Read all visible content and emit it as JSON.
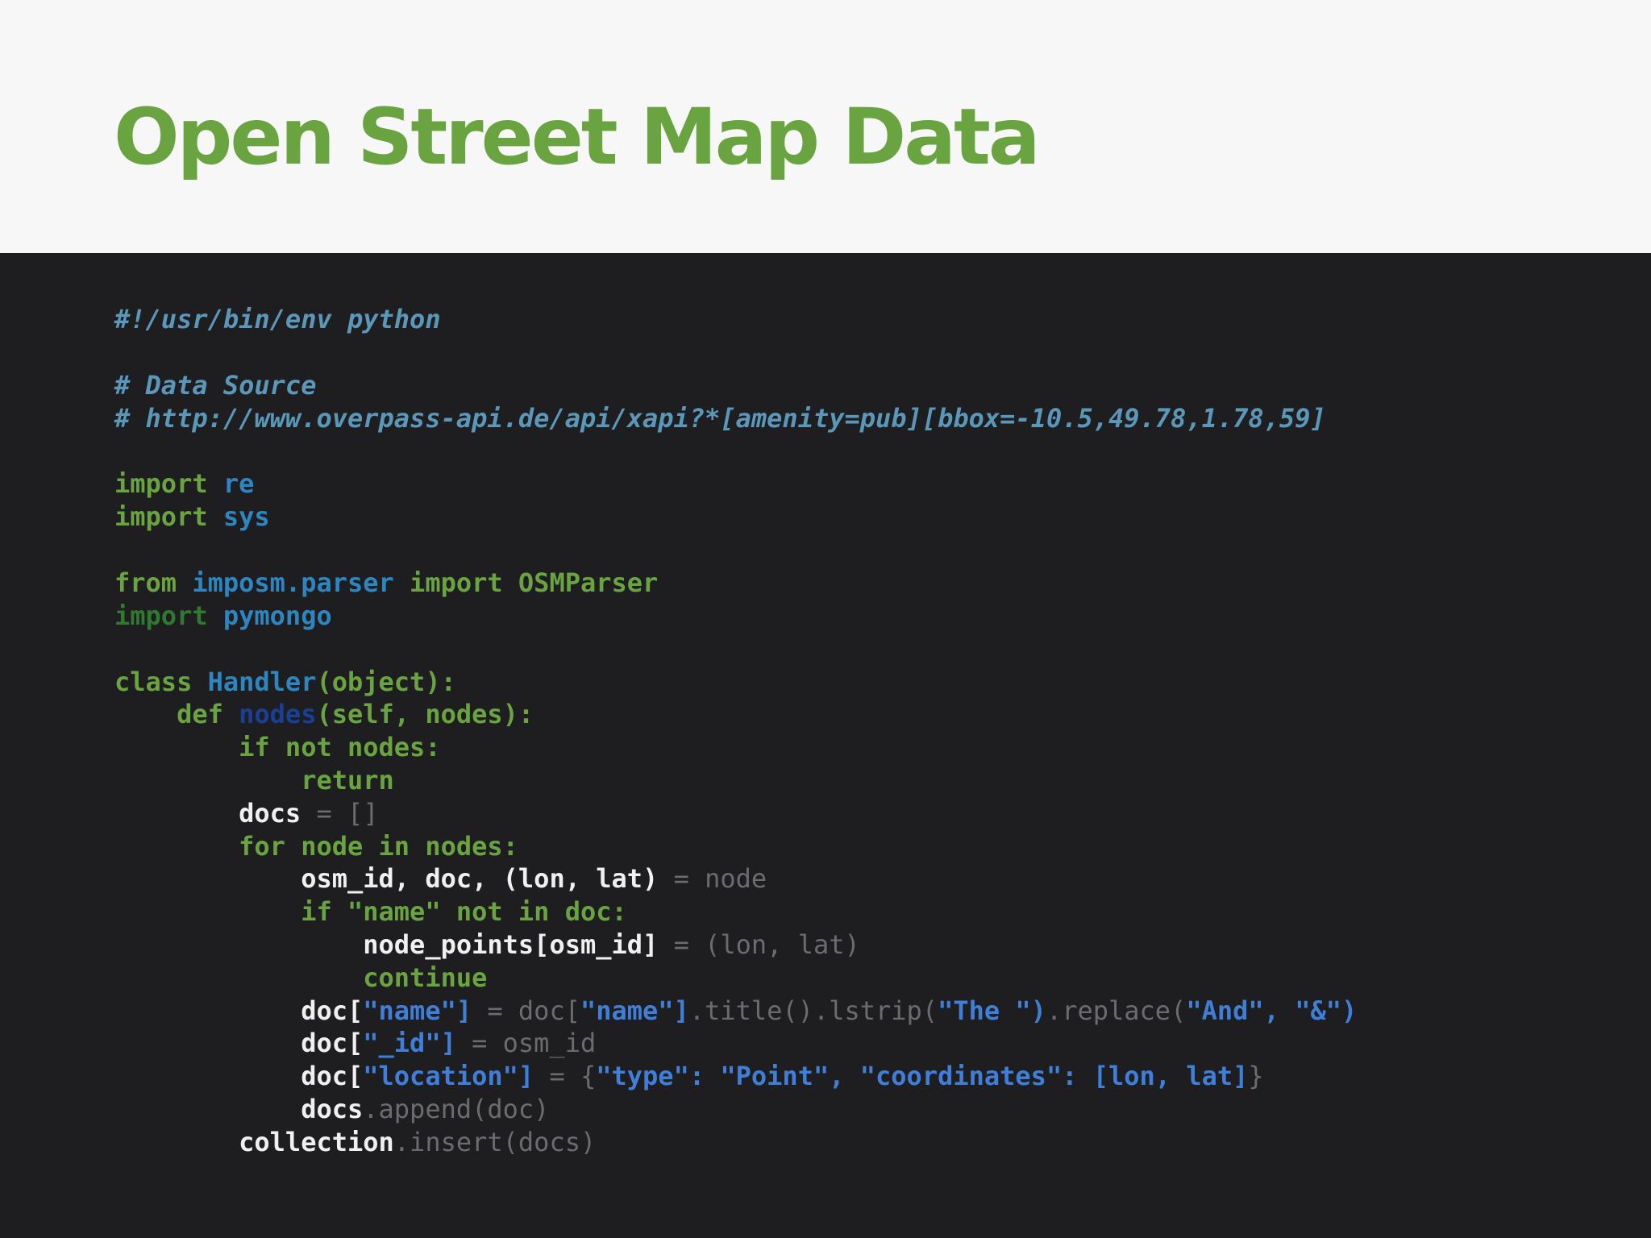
{
  "slide": {
    "title": "Open Street Map Data"
  },
  "code": {
    "language": "python",
    "lines": [
      {
        "indent": 0,
        "tokens": [
          {
            "t": "#!/usr/bin/env python",
            "k": "comment"
          }
        ]
      },
      {
        "indent": 0,
        "tokens": []
      },
      {
        "indent": 0,
        "tokens": [
          {
            "t": "# Data Source",
            "k": "comment"
          }
        ]
      },
      {
        "indent": 0,
        "tokens": [
          {
            "t": "# http://www.overpass-api.de/api/xapi?*[amenity=pub][bbox=-10.5,49.78,1.78,59]",
            "k": "comment"
          }
        ]
      },
      {
        "indent": 0,
        "tokens": []
      },
      {
        "indent": 0,
        "tokens": [
          {
            "t": "import",
            "k": "keyword"
          },
          {
            "t": " ",
            "k": "ident"
          },
          {
            "t": "re",
            "k": "module"
          }
        ]
      },
      {
        "indent": 0,
        "tokens": [
          {
            "t": "import",
            "k": "keyword"
          },
          {
            "t": " ",
            "k": "ident"
          },
          {
            "t": "sys",
            "k": "module"
          }
        ]
      },
      {
        "indent": 0,
        "tokens": []
      },
      {
        "indent": 0,
        "tokens": [
          {
            "t": "from",
            "k": "keyword"
          },
          {
            "t": " ",
            "k": "ident"
          },
          {
            "t": "imposm.parser",
            "k": "module"
          },
          {
            "t": " ",
            "k": "ident"
          },
          {
            "t": "import",
            "k": "keyword"
          },
          {
            "t": " OSMParser",
            "k": "keyword"
          }
        ]
      },
      {
        "indent": 0,
        "tokens": [
          {
            "t": "import",
            "k": "keyword-dim"
          },
          {
            "t": " ",
            "k": "ident"
          },
          {
            "t": "pymongo",
            "k": "module"
          }
        ]
      },
      {
        "indent": 0,
        "tokens": []
      },
      {
        "indent": 0,
        "tokens": [
          {
            "t": "class",
            "k": "keyword"
          },
          {
            "t": " ",
            "k": "ident"
          },
          {
            "t": "Handler",
            "k": "class"
          },
          {
            "t": "(object):",
            "k": "keyword"
          }
        ]
      },
      {
        "indent": 1,
        "tokens": [
          {
            "t": "def",
            "k": "keyword"
          },
          {
            "t": " ",
            "k": "ident"
          },
          {
            "t": "nodes",
            "k": "fn"
          },
          {
            "t": "(self, nodes):",
            "k": "keyword"
          }
        ]
      },
      {
        "indent": 2,
        "tokens": [
          {
            "t": "if not nodes:",
            "k": "keyword"
          }
        ]
      },
      {
        "indent": 3,
        "tokens": [
          {
            "t": "return",
            "k": "keyword"
          }
        ]
      },
      {
        "indent": 2,
        "tokens": [
          {
            "t": "docs",
            "k": "ident"
          },
          {
            "t": " = []",
            "k": "op"
          }
        ]
      },
      {
        "indent": 2,
        "tokens": [
          {
            "t": "for node in nodes:",
            "k": "keyword"
          }
        ]
      },
      {
        "indent": 3,
        "tokens": [
          {
            "t": "osm_id, doc, (lon, lat)",
            "k": "ident"
          },
          {
            "t": " = node",
            "k": "op"
          }
        ]
      },
      {
        "indent": 3,
        "tokens": [
          {
            "t": "if \"name\" not in doc:",
            "k": "keyword"
          }
        ]
      },
      {
        "indent": 4,
        "tokens": [
          {
            "t": "node_points[osm_id]",
            "k": "ident"
          },
          {
            "t": " = (lon, lat)",
            "k": "op"
          }
        ]
      },
      {
        "indent": 4,
        "tokens": [
          {
            "t": "continue",
            "k": "keyword"
          }
        ]
      },
      {
        "indent": 3,
        "tokens": [
          {
            "t": "doc[",
            "k": "ident"
          },
          {
            "t": "\"name\"]",
            "k": "str"
          },
          {
            "t": " = doc[",
            "k": "op"
          },
          {
            "t": "\"name\"]",
            "k": "str"
          },
          {
            "t": ".title().lstrip(",
            "k": "op"
          },
          {
            "t": "\"The \")",
            "k": "str"
          },
          {
            "t": ".replace(",
            "k": "op"
          },
          {
            "t": "\"And\", \"&\")",
            "k": "str"
          }
        ]
      },
      {
        "indent": 3,
        "tokens": [
          {
            "t": "doc[",
            "k": "ident"
          },
          {
            "t": "\"_id\"]",
            "k": "str"
          },
          {
            "t": " = osm_id",
            "k": "op"
          }
        ]
      },
      {
        "indent": 3,
        "tokens": [
          {
            "t": "doc[",
            "k": "ident"
          },
          {
            "t": "\"location\"]",
            "k": "str"
          },
          {
            "t": " = {",
            "k": "op"
          },
          {
            "t": "\"type\": \"Point\", \"coordinates\": [lon, lat]",
            "k": "str"
          },
          {
            "t": "}",
            "k": "op"
          }
        ]
      },
      {
        "indent": 3,
        "tokens": [
          {
            "t": "docs",
            "k": "ident"
          },
          {
            "t": ".append(doc)",
            "k": "op"
          }
        ]
      },
      {
        "indent": 2,
        "tokens": [
          {
            "t": "collection",
            "k": "ident"
          },
          {
            "t": ".insert(docs)",
            "k": "op"
          }
        ]
      }
    ]
  }
}
